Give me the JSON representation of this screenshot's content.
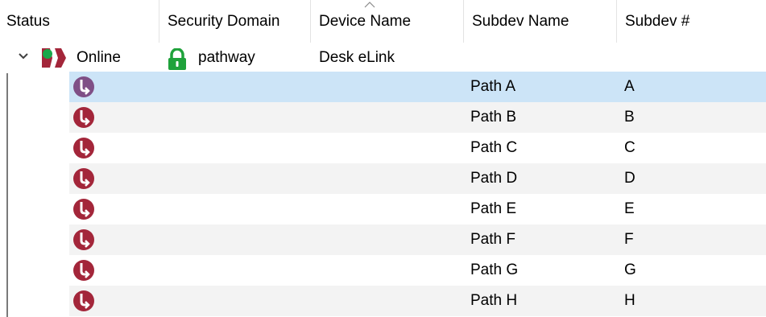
{
  "columns": {
    "status": "Status",
    "security_domain": "Security Domain",
    "device_name": "Device Name",
    "subdev_name": "Subdev Name",
    "subdev_num": "Subdev #"
  },
  "sort": {
    "column": "device_name",
    "direction": "ascending",
    "icon": "sort-ascending-icon"
  },
  "device": {
    "status": "Online",
    "status_icon": "online-device-icon",
    "security_domain": "pathway",
    "security_icon": "unlocked-padlock-icon",
    "device_name": "Desk eLink",
    "expanded": true
  },
  "subdevices": [
    {
      "name": "Path A",
      "num": "A",
      "selected": true
    },
    {
      "name": "Path B",
      "num": "B"
    },
    {
      "name": "Path C",
      "num": "C"
    },
    {
      "name": "Path D",
      "num": "D"
    },
    {
      "name": "Path E",
      "num": "E"
    },
    {
      "name": "Path F",
      "num": "F"
    },
    {
      "name": "Path G",
      "num": "G"
    },
    {
      "name": "Path H",
      "num": "H"
    }
  ],
  "colors": {
    "selection": "#cce4f7",
    "alt_row": "#f3f3f3",
    "path_icon": "#a3263a",
    "path_icon_selected": "#7f4f86",
    "online_green": "#18a84a",
    "lock_green": "#1fa23b"
  }
}
